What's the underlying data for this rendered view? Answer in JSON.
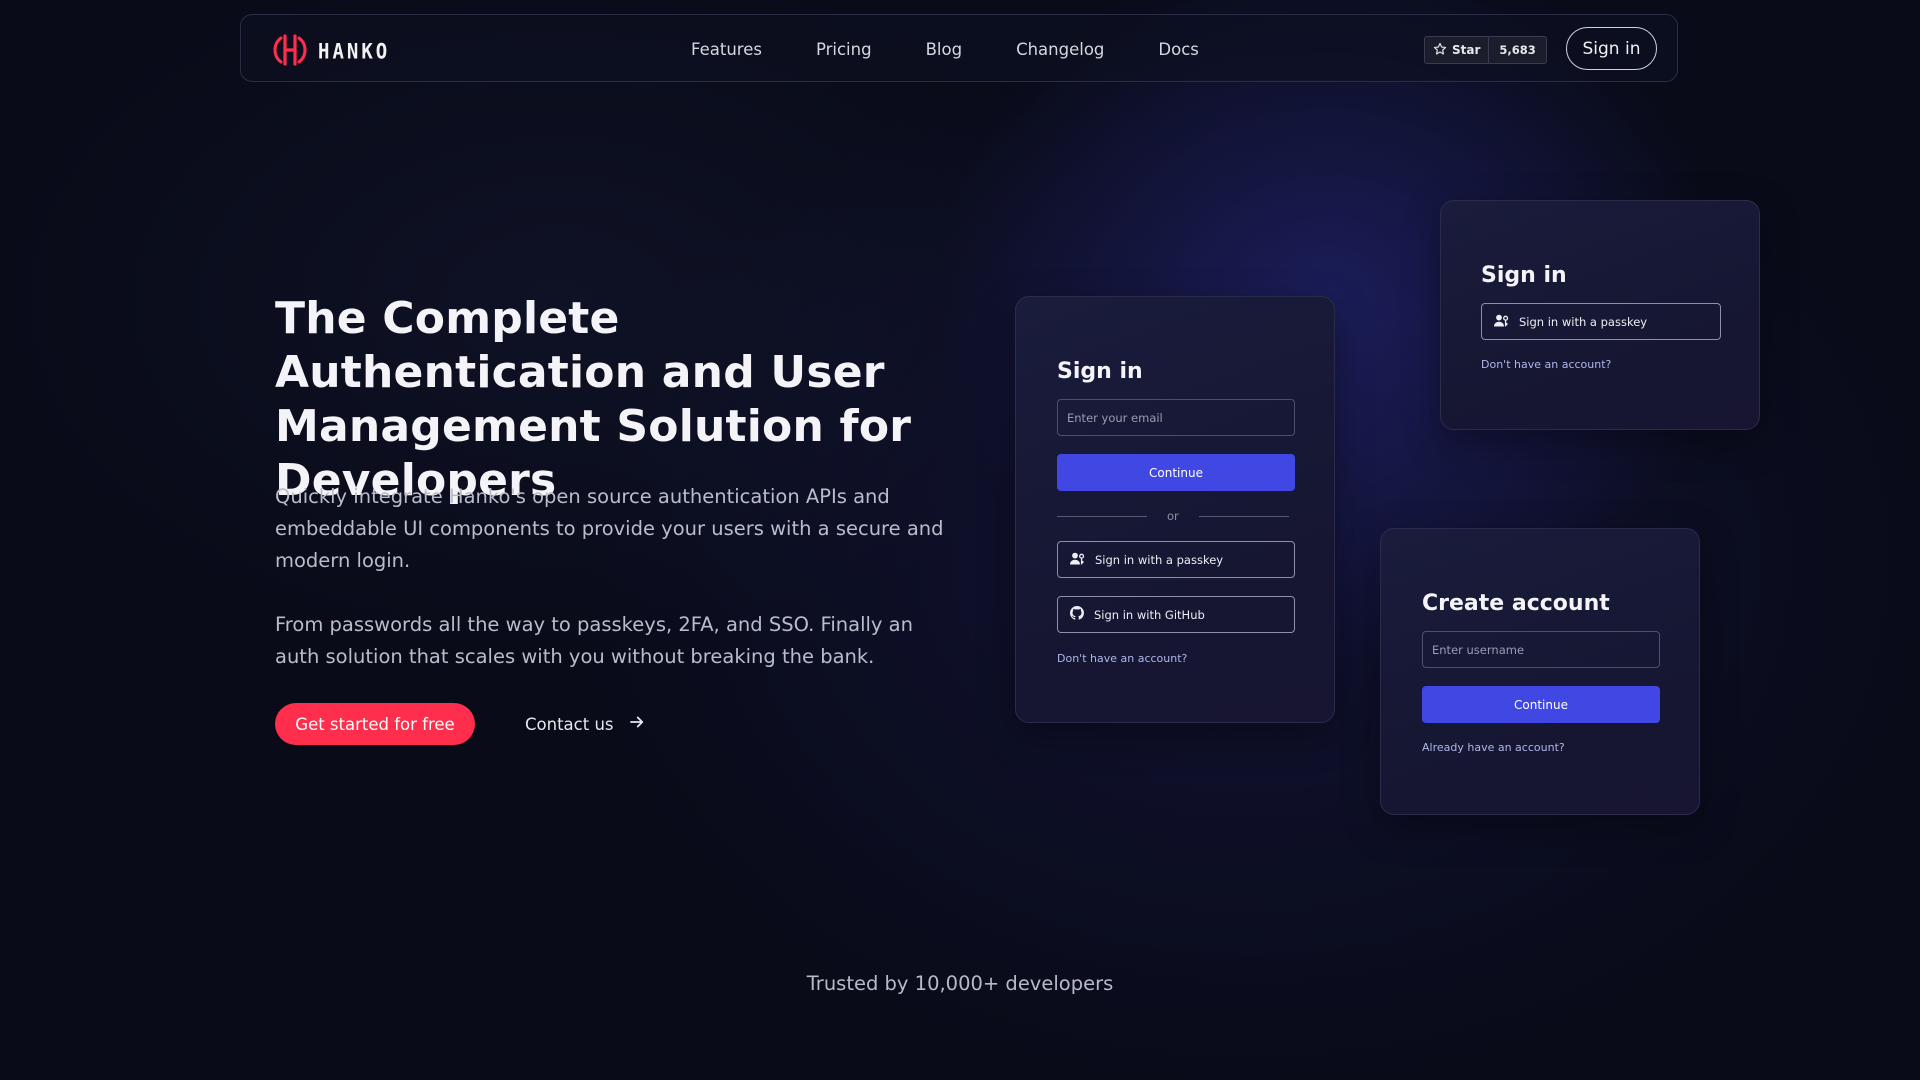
{
  "nav": {
    "logo_text": "HANKO",
    "links": [
      "Features",
      "Pricing",
      "Blog",
      "Changelog",
      "Docs"
    ],
    "github": {
      "star_label": "Star",
      "star_count": "5,683"
    },
    "signin_label": "Sign in"
  },
  "hero": {
    "title": "The Complete Authentication and User Management Solution for Developers",
    "paragraph1": "Quickly integrate Hanko's open source authentication APIs and embeddable UI components to provide your users with a secure and modern login.",
    "paragraph2": "From passwords all the way to passkeys, 2FA, and SSO. Finally an auth solution that scales with you without breaking the bank.",
    "cta_primary": "Get started for free",
    "cta_secondary": "Contact us"
  },
  "card_main": {
    "title": "Sign in",
    "email_placeholder": "Enter your email",
    "continue_label": "Continue",
    "divider_text": "or",
    "passkey_label": "Sign in with a passkey",
    "github_label": "Sign in with GitHub",
    "no_account_link": "Don't have an account?"
  },
  "card_top_right": {
    "title": "Sign in",
    "passkey_label": "Sign in with a passkey",
    "no_account_link": "Don't have an account?"
  },
  "card_create": {
    "title": "Create account",
    "username_placeholder": "Enter username",
    "continue_label": "Continue",
    "have_account_link": "Already have an account?"
  },
  "trusted_text": "Trusted by 10,000+ developers",
  "colors": {
    "background": "#090b19",
    "accent_red": "#ff2e4c",
    "accent_blue": "#4047e2"
  }
}
